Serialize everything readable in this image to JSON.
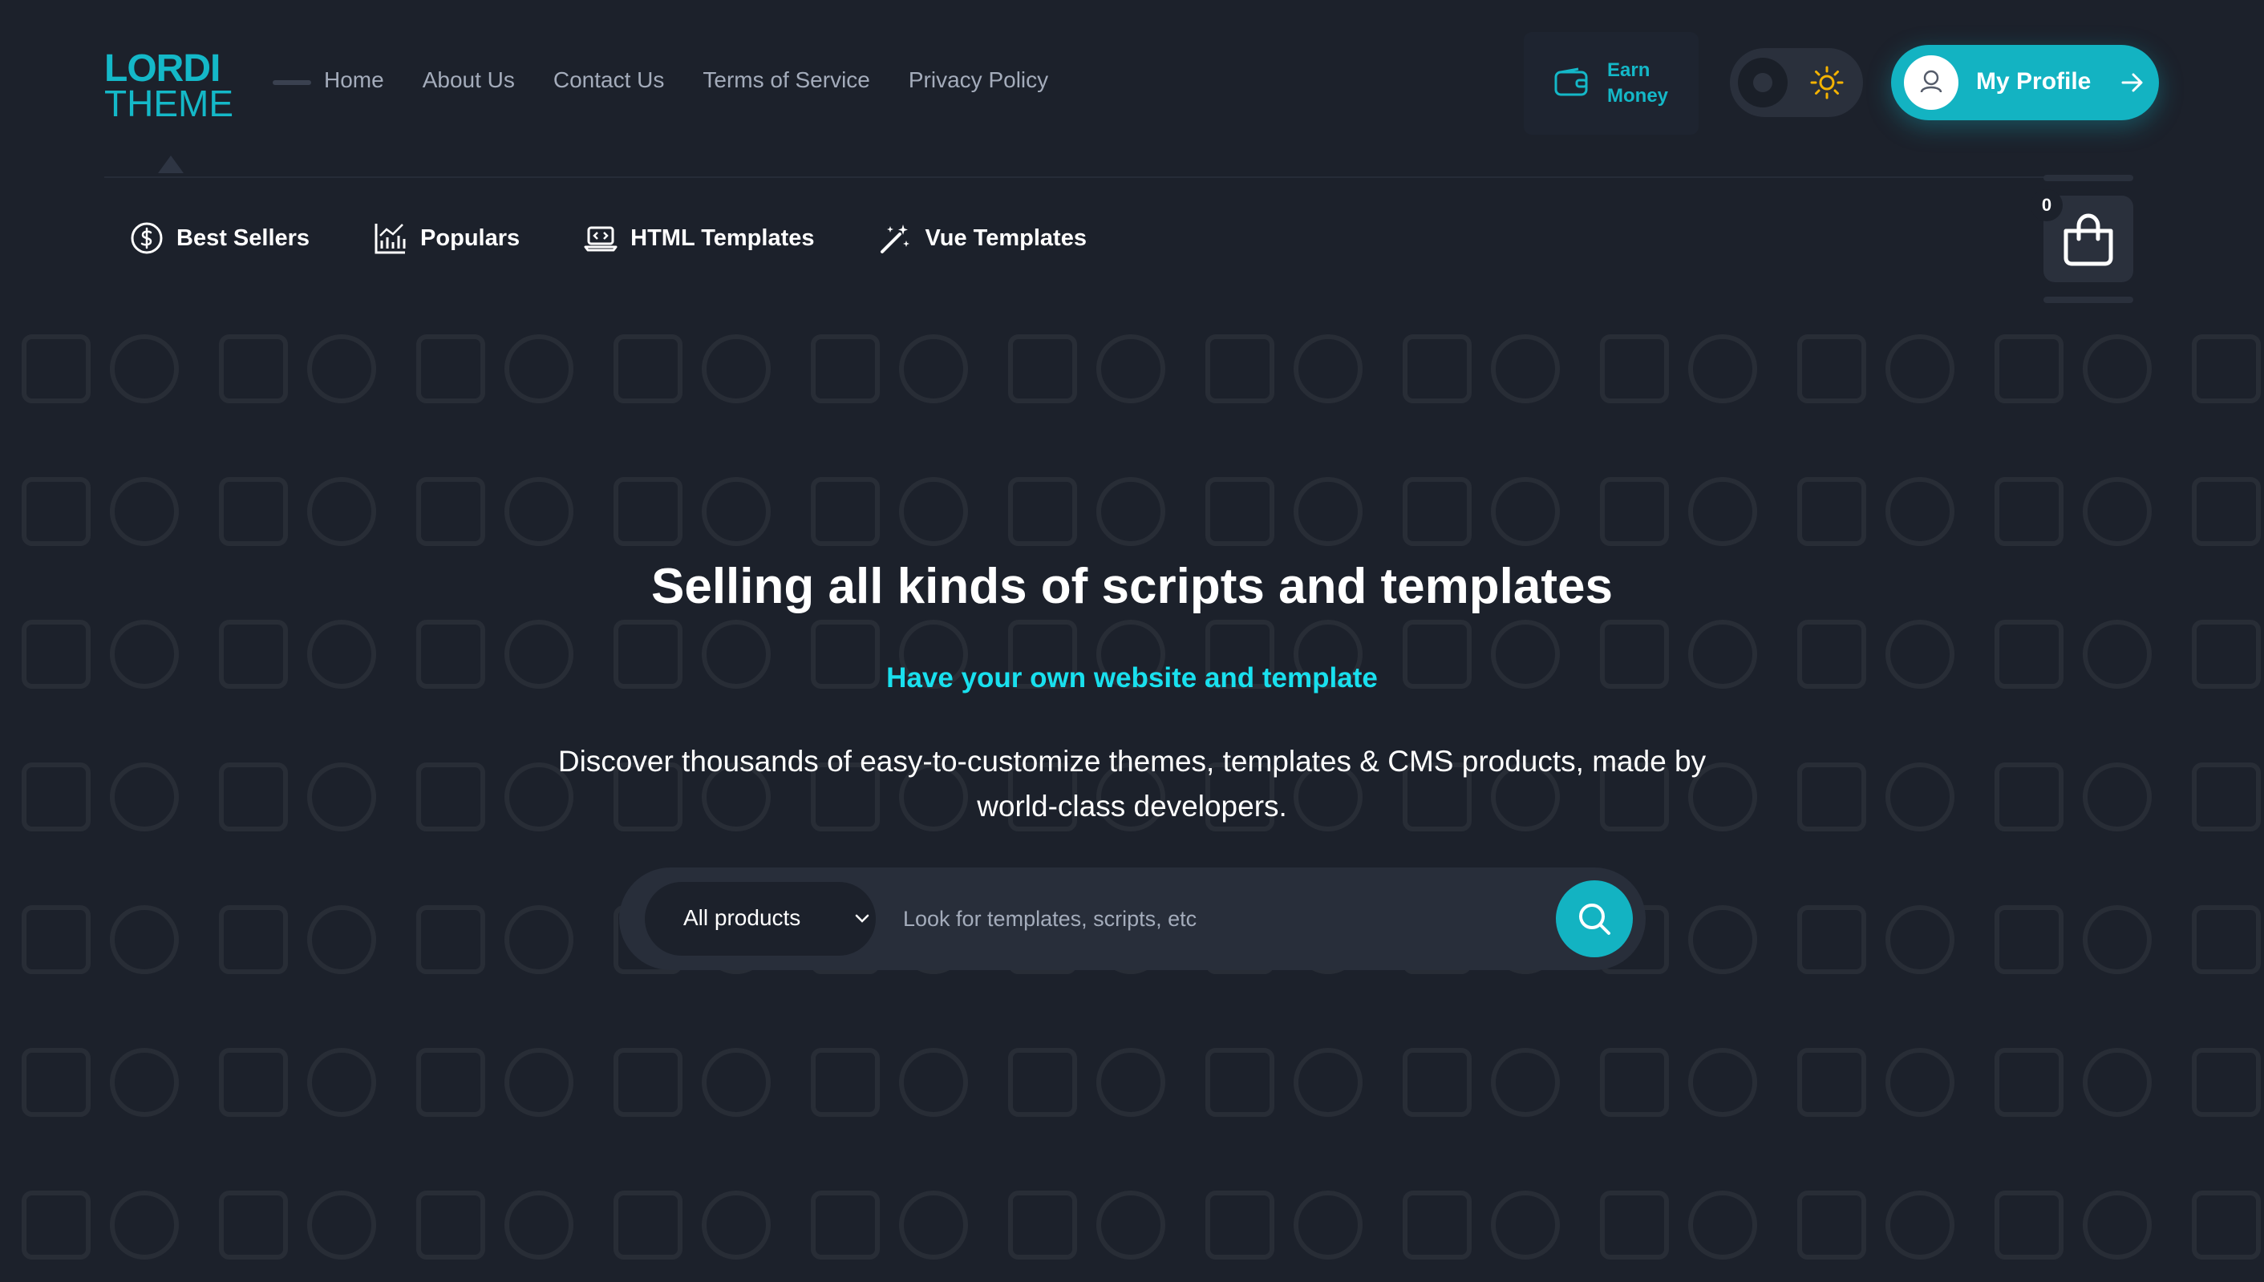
{
  "colors": {
    "background": "#1c212b",
    "accent": "#13b3c2",
    "accent_text": "#19e0ee",
    "sun": "#f5b301"
  },
  "logo": {
    "line1": "LORDI",
    "line2": "THEME"
  },
  "nav": {
    "items": [
      "Home",
      "About Us",
      "Contact Us",
      "Terms of Service",
      "Privacy Policy"
    ]
  },
  "earn": {
    "line1": "Earn",
    "line2": "Money",
    "icon": "wallet-icon"
  },
  "theme_toggle": {
    "icon": "sun-icon"
  },
  "profile": {
    "label": "My Profile",
    "icon": "user-icon",
    "arrow": "arrow-right-icon"
  },
  "categories": [
    {
      "label": "Best Sellers",
      "icon": "dollar-circle-icon"
    },
    {
      "label": "Populars",
      "icon": "bar-chart-icon"
    },
    {
      "label": "HTML Templates",
      "icon": "laptop-code-icon"
    },
    {
      "label": "Vue Templates",
      "icon": "magic-wand-icon"
    }
  ],
  "cart": {
    "count": "0",
    "icon": "shopping-bag-icon"
  },
  "hero": {
    "title": "Selling all kinds of scripts and templates",
    "subtitle": "Have your own website and template",
    "description": "Discover thousands of easy-to-customize themes, templates & CMS products, made by world-class developers."
  },
  "search": {
    "category": "All products",
    "placeholder": "Look for templates, scripts, etc",
    "value": "",
    "icon": "search-icon"
  }
}
